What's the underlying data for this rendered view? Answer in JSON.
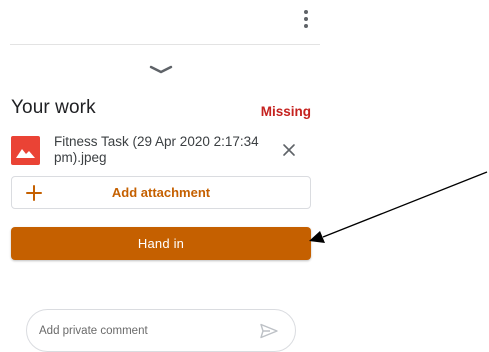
{
  "header": {
    "more_icon": "more-vert-icon"
  },
  "sheet": {
    "collapse_icon": "chevron-down-icon"
  },
  "your_work": {
    "title": "Your work",
    "status": "Missing",
    "status_color": "#c5221f",
    "attachment": {
      "icon": "image-file-icon",
      "icon_color": "#ea4335",
      "file_name": "Fitness Task (29 Apr 2020 2:17:34 pm).jpeg",
      "remove_icon": "close-icon"
    },
    "add_attachment": {
      "icon": "plus-icon",
      "label": "Add attachment"
    },
    "hand_in": {
      "label": "Hand in"
    },
    "accent_color": "#c56000"
  },
  "private_comment": {
    "placeholder": "Add private comment",
    "send_icon": "send-icon"
  },
  "annotation": {
    "arrow_icon": "pointer-arrow-icon"
  }
}
